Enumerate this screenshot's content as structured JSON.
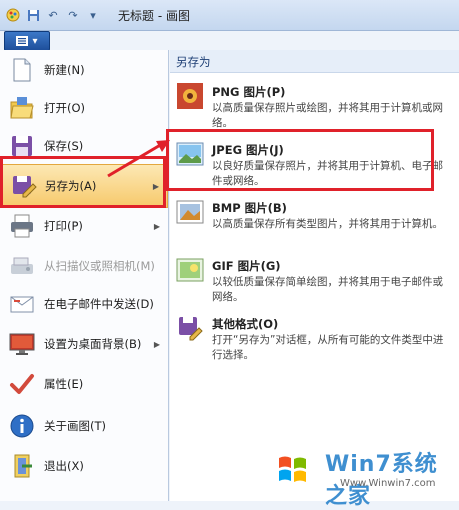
{
  "window": {
    "title": "无标题 - 画图"
  },
  "menu_items": [
    {
      "label": "新建(N)",
      "icon": "new-icon",
      "has_arrow": false,
      "disabled": false,
      "active": false
    },
    {
      "label": "打开(O)",
      "icon": "open-icon",
      "has_arrow": false,
      "disabled": false,
      "active": false
    },
    {
      "label": "保存(S)",
      "icon": "save-icon",
      "has_arrow": false,
      "disabled": false,
      "active": false
    },
    {
      "label": "另存为(A)",
      "icon": "save-as-icon",
      "has_arrow": true,
      "disabled": false,
      "active": true
    },
    {
      "label": "打印(P)",
      "icon": "print-icon",
      "has_arrow": true,
      "disabled": false,
      "active": false
    },
    {
      "label": "从扫描仪或照相机(M)",
      "icon": "scanner-icon",
      "has_arrow": false,
      "disabled": true,
      "active": false
    },
    {
      "label": "在电子邮件中发送(D)",
      "icon": "email-icon",
      "has_arrow": false,
      "disabled": false,
      "active": false
    },
    {
      "label": "设置为桌面背景(B)",
      "icon": "desktop-icon",
      "has_arrow": true,
      "disabled": false,
      "active": false
    },
    {
      "label": "属性(E)",
      "icon": "properties-icon",
      "has_arrow": false,
      "disabled": false,
      "active": false
    },
    {
      "label": "关于画图(T)",
      "icon": "info-icon",
      "has_arrow": false,
      "disabled": false,
      "active": false
    },
    {
      "label": "退出(X)",
      "icon": "exit-icon",
      "has_arrow": false,
      "disabled": false,
      "active": false
    }
  ],
  "submenu": {
    "header": "另存为",
    "items": [
      {
        "title": "PNG 图片(P)",
        "desc": "以高质量保存照片或绘图，并将其用于计算机或网络。",
        "icon": "png-icon"
      },
      {
        "title": "JPEG 图片(J)",
        "desc": "以良好质量保存照片，并将其用于计算机、电子邮件或网络。",
        "icon": "jpeg-icon"
      },
      {
        "title": "BMP 图片(B)",
        "desc": "以高质量保存所有类型图片，并将其用于计算机。",
        "icon": "bmp-icon"
      },
      {
        "title": "GIF 图片(G)",
        "desc": "以较低质量保存简单绘图，并将其用于电子邮件或网络。",
        "icon": "gif-icon"
      },
      {
        "title": "其他格式(O)",
        "desc": "打开“另存为”对话框，从所有可能的文件类型中进行选择。",
        "icon": "other-format-icon"
      }
    ]
  },
  "watermark": {
    "text": "Win7系统之家",
    "url": "Www.Winwin7.com"
  },
  "colors": {
    "accent_red": "#e0212a",
    "menu_button": "#2a5fae",
    "hover": "#f7c96b"
  }
}
